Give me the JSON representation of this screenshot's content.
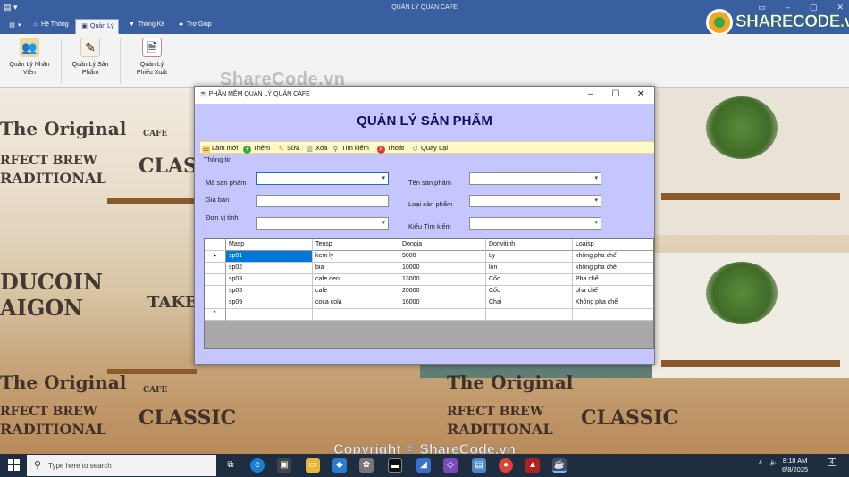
{
  "app": {
    "title": "QUẢN LÝ QUÁN CAFE",
    "quick_access": "▤ ▾"
  },
  "ribbon": {
    "tabs": [
      {
        "label": "Hệ Thống"
      },
      {
        "label": "Quản Lý"
      },
      {
        "label": "Thống Kê"
      },
      {
        "label": "Trợ Giúp"
      }
    ],
    "buttons": [
      {
        "label": "Quản Lý Nhân Viên"
      },
      {
        "label": "Quản Lý Sản Phẩm"
      },
      {
        "label1": "Quản Lý",
        "label2": "Phiếu Xuất"
      }
    ]
  },
  "watermark": {
    "top": "ShareCode.vn",
    "bottom": "Copyright © ShareCode.vn"
  },
  "logo": {
    "text": "SHARECODE.vn"
  },
  "wallpaper": {
    "texts": [
      "The Original",
      "CLASSIC",
      "CAFE",
      "RFECT BREW",
      "RADITIONAL",
      "DUCOIN",
      "AIGON",
      "TAKE A",
      "The Original",
      "CLASSIC",
      "CAFE",
      "RFECT BREW",
      "RADITIONAL"
    ]
  },
  "dialog": {
    "title": "PHẦN MỀM QUẢN LÝ QUÁN CAFE",
    "heading": "QUẢN LÝ SẢN PHẨM",
    "toolbar": [
      {
        "label": "Làm mới",
        "icon": "folder-icon"
      },
      {
        "label": "Thêm",
        "icon": "add-icon"
      },
      {
        "label": "Sửa",
        "icon": "edit-icon"
      },
      {
        "label": "Xóa",
        "icon": "delete-icon"
      },
      {
        "label": "Tìm kiếm",
        "icon": "search-icon"
      },
      {
        "label": "Thoát",
        "icon": "exit-icon"
      },
      {
        "label": "Quay Lại",
        "icon": "back-icon"
      }
    ],
    "group_label": "Thông tin",
    "fields": {
      "ma_sp": "Mã sản phẩm",
      "gia_ban": "Giá bán",
      "don_vi_tinh": "Đơn vị tính",
      "ten_sp": "Tên sản phẩm",
      "loai_sp": "Loại sản phẩm",
      "kieu_tim_kiem": "Kiểu Tìm kiếm"
    },
    "grid": {
      "columns": [
        "Masp",
        "Tensp",
        "Dongia",
        "Donvitinh",
        "Loaisp"
      ],
      "rows": [
        [
          "sp01",
          "kem ly",
          "9000",
          "Ly",
          "không pha chế"
        ],
        [
          "sp02",
          "bia",
          "10000",
          "lon",
          "không pha chế"
        ],
        [
          "sp03",
          "cafe den",
          "13000",
          "Cốc",
          "Pha chế"
        ],
        [
          "sp05",
          "cafe",
          "20000",
          "Cốc",
          "pha chế"
        ],
        [
          "sp09",
          "coca cola",
          "16000",
          "Chai",
          "Không pha chế"
        ]
      ],
      "new_row_marker": "*",
      "current_row_marker": "▸"
    }
  },
  "taskbar": {
    "search_placeholder": "Type here to search",
    "time": "8:18 AM",
    "date": "6/8/2025",
    "notification_count": "4"
  }
}
